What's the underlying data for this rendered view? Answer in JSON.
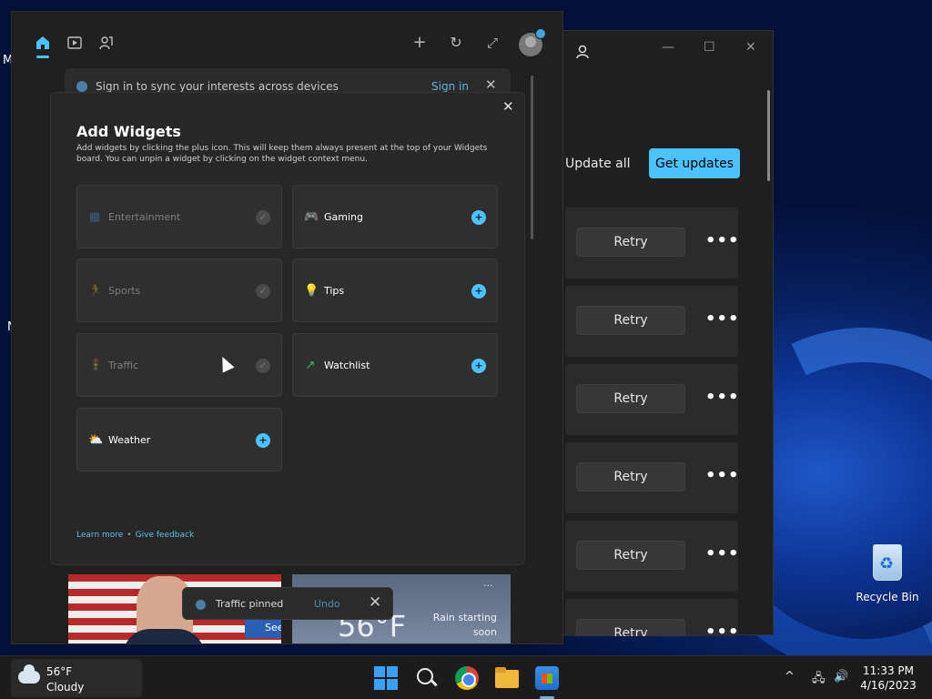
{
  "desktop": {
    "left_fragments": [
      "M",
      "N"
    ],
    "recycle_bin_label": "Recycle Bin"
  },
  "store": {
    "update_all_label": "Update all",
    "get_updates_label": "Get updates",
    "retry_label": "Retry",
    "more_label": "•••",
    "window_controls": {
      "minimize": "—",
      "maximize": "☐",
      "close": "✕"
    }
  },
  "widgets_board": {
    "signin_banner": {
      "message": "Sign in to sync your interests across devices",
      "signin_label": "Sign in",
      "close_glyph": "✕"
    },
    "top_icons": {
      "add": "+",
      "refresh": "↻",
      "expand": "⤢"
    },
    "news": {
      "see_more_label": "See more",
      "weather_temp": "56°F",
      "rain_text": "Rain starting soon",
      "more_glyph": "···"
    }
  },
  "add_widgets_dialog": {
    "title": "Add Widgets",
    "description": "Add widgets by clicking the plus icon. This will keep them always present at the top of your Widgets board. You can unpin a widget by clicking on the widget context menu.",
    "close_glyph": "✕",
    "widgets": [
      {
        "name": "Entertainment",
        "state": "pinned",
        "icon": "entertainment-icon",
        "glyph": "▦",
        "color": "#4a90d9"
      },
      {
        "name": "Gaming",
        "state": "add",
        "icon": "gamepad-icon",
        "glyph": "🎮",
        "color": "#9b7be8"
      },
      {
        "name": "Sports",
        "state": "pinned",
        "icon": "runner-icon",
        "glyph": "🏃",
        "color": "#7a6ae0"
      },
      {
        "name": "Tips",
        "state": "add",
        "icon": "lightbulb-icon",
        "glyph": "💡",
        "color": "#4cc2ff"
      },
      {
        "name": "Traffic",
        "state": "pinned",
        "icon": "traffic-light-icon",
        "glyph": "🚦",
        "color": "#7bb36a"
      },
      {
        "name": "Watchlist",
        "state": "add",
        "icon": "trend-up-icon",
        "glyph": "↗",
        "color": "#3fbf5a"
      },
      {
        "name": "Weather",
        "state": "add",
        "icon": "sun-cloud-icon",
        "glyph": "⛅",
        "color": "#f2b431"
      }
    ],
    "plus_glyph": "+",
    "check_glyph": "✓",
    "learn_more_label": "Learn more",
    "separator": "•",
    "give_feedback_label": "Give feedback"
  },
  "toast": {
    "message": "Traffic pinned",
    "undo_label": "Undo",
    "close_glyph": "✕"
  },
  "taskbar": {
    "weather": {
      "temp": "56°F",
      "condition": "Cloudy"
    },
    "tray": {
      "chevron": "^",
      "network": "🖧",
      "volume": "🔊"
    },
    "clock": {
      "time": "11:33 PM",
      "date": "4/16/2023"
    }
  },
  "colors": {
    "accent": "#4cc2ff",
    "link": "#5fb6d6"
  }
}
